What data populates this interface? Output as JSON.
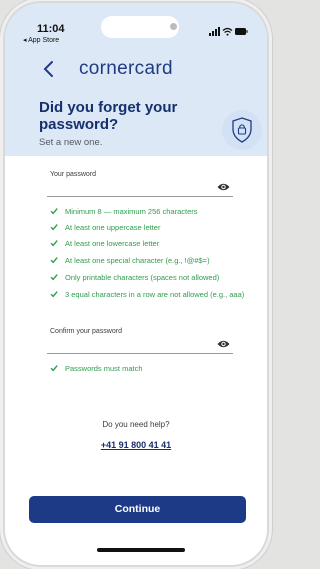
{
  "status": {
    "time": "11:04",
    "back_app": "◂ App Store"
  },
  "header": {
    "logo_text": "cornercard",
    "title": "Did you forget your password?",
    "subtitle": "Set a new one."
  },
  "password_field": {
    "label": "Your password",
    "value": ""
  },
  "rules": [
    "Minimum 8 — maximum 256 characters",
    "At least one uppercase letter",
    "At least one lowercase letter",
    "At least one special character (e.g., !@#$=)",
    "Only printable characters (spaces not allowed)",
    "3 equal characters in a row are not allowed (e.g., aaa)"
  ],
  "confirm_field": {
    "label": "Confirm your password",
    "value": ""
  },
  "confirm_rule": "Passwords must match",
  "help": {
    "label": "Do you need help?",
    "phone": "+41 91 800 41 41"
  },
  "continue_label": "Continue",
  "colors": {
    "brand": "#1c3a85",
    "success": "#2e9e4d",
    "header_bg": "#dde8f6"
  }
}
